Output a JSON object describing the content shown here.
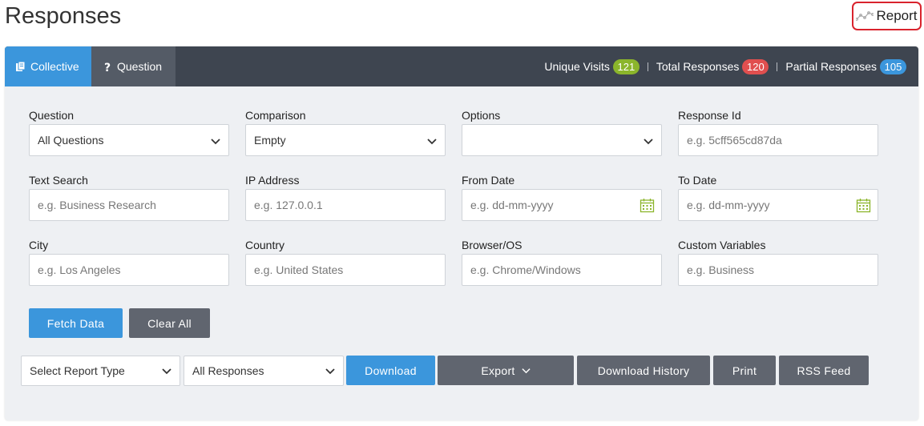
{
  "page": {
    "title": "Responses",
    "report_label": "Report"
  },
  "tabs": [
    {
      "label": "Collective"
    },
    {
      "label": "Question"
    }
  ],
  "stats": [
    {
      "label": "Unique Visits",
      "value": "121",
      "color": "#8bb52b"
    },
    {
      "label": "Total Responses",
      "value": "120",
      "color": "#e04f4f"
    },
    {
      "label": "Partial Responses",
      "value": "105",
      "color": "#3b96dc"
    }
  ],
  "filters": {
    "question": {
      "label": "Question",
      "value": "All Questions"
    },
    "comparison": {
      "label": "Comparison",
      "value": "Empty"
    },
    "options": {
      "label": "Options",
      "value": ""
    },
    "response_id": {
      "label": "Response Id",
      "placeholder": "e.g. 5cff565cd87da"
    },
    "text_search": {
      "label": "Text Search",
      "placeholder": "e.g. Business Research"
    },
    "ip_address": {
      "label": "IP Address",
      "placeholder": "e.g. 127.0.0.1"
    },
    "from_date": {
      "label": "From Date",
      "placeholder": "e.g. dd-mm-yyyy"
    },
    "to_date": {
      "label": "To Date",
      "placeholder": "e.g. dd-mm-yyyy"
    },
    "city": {
      "label": "City",
      "placeholder": "e.g. Los Angeles"
    },
    "country": {
      "label": "Country",
      "placeholder": "e.g. United States"
    },
    "browser_os": {
      "label": "Browser/OS",
      "placeholder": "e.g. Chrome/Windows"
    },
    "custom_variables": {
      "label": "Custom Variables",
      "placeholder": "e.g. Business"
    }
  },
  "actions": {
    "fetch": "Fetch Data",
    "clear": "Clear All"
  },
  "toolbar": {
    "report_type": "Select Report Type",
    "response_filter": "All Responses",
    "download": "Download",
    "export": "Export",
    "download_history": "Download History",
    "print": "Print",
    "rss": "RSS Feed"
  },
  "colors": {
    "accent": "#3b96dc",
    "header": "#3e4550",
    "button_grey": "#60656f",
    "highlight": "#d9232d",
    "calendar": "#8bb52b"
  }
}
